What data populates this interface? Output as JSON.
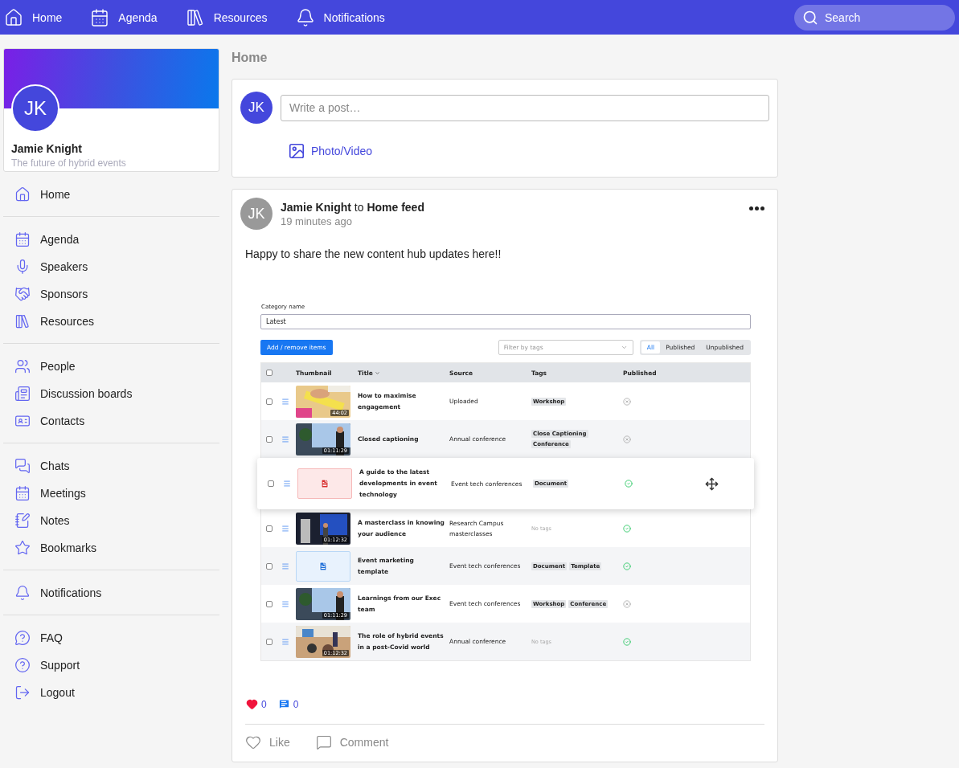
{
  "topnav": {
    "items": [
      {
        "label": "Home"
      },
      {
        "label": "Agenda"
      },
      {
        "label": "Resources"
      },
      {
        "label": "Notifications"
      }
    ],
    "search": {
      "placeholder": "Search"
    }
  },
  "profile": {
    "initials": "JK",
    "name": "Jamie Knight",
    "tagline": "The future of hybrid events"
  },
  "sidebar": {
    "groups": [
      {
        "items": [
          {
            "label": "Home"
          }
        ]
      },
      {
        "items": [
          {
            "label": "Agenda"
          },
          {
            "label": "Speakers"
          },
          {
            "label": "Sponsors"
          },
          {
            "label": "Resources"
          }
        ]
      },
      {
        "items": [
          {
            "label": "People"
          },
          {
            "label": "Discussion boards"
          },
          {
            "label": "Contacts"
          }
        ]
      },
      {
        "items": [
          {
            "label": "Chats"
          },
          {
            "label": "Meetings"
          },
          {
            "label": "Notes"
          },
          {
            "label": "Bookmarks"
          }
        ]
      },
      {
        "items": [
          {
            "label": "Notifications"
          }
        ]
      },
      {
        "items": [
          {
            "label": "FAQ"
          },
          {
            "label": "Support"
          },
          {
            "label": "Logout"
          }
        ]
      }
    ]
  },
  "page_title": "Home",
  "composer": {
    "initials": "JK",
    "placeholder": "Write a post…",
    "photo_label": "Photo/Video"
  },
  "post": {
    "initials": "JK",
    "author": "Jamie Knight",
    "connector": "to",
    "target": "Home feed",
    "time": "19 minutes ago",
    "text": "Happy to share the new content hub updates here!!",
    "embed": {
      "category_label": "Category name",
      "category_value": "Latest",
      "add_button": "Add / remove items",
      "filter_placeholder": "Filter by tags",
      "segments": [
        {
          "label": "All",
          "selected": true
        },
        {
          "label": "Published",
          "selected": false
        },
        {
          "label": "Unpublished",
          "selected": false
        }
      ],
      "header_checked": false,
      "columns": [
        "Thumbnail",
        "Title",
        "Source",
        "Tags",
        "Published"
      ],
      "rows": [
        {
          "kind": "video",
          "checked": false,
          "dragging": false,
          "duration": "44:02",
          "title": "How to maximise engagement",
          "source": "Uploaded",
          "tags": [
            "Workshop"
          ],
          "published": false
        },
        {
          "kind": "video",
          "checked": false,
          "dragging": false,
          "duration": "01:11:29",
          "title": "Closed captioning",
          "source": "Annual conference",
          "tags": [
            "Close Captioning",
            "Conference"
          ],
          "published": false
        },
        {
          "kind": "pdf",
          "checked": false,
          "dragging": true,
          "title": "A guide to the latest developments in event technology",
          "source": "Event tech conferences",
          "tags": [
            "Document"
          ],
          "published": true
        },
        {
          "kind": "video",
          "checked": false,
          "dragging": false,
          "duration": "01:12:32",
          "title": "A masterclass in knowing your audience",
          "source": "Research Campus masterclasses",
          "tags_note": "No tags",
          "published": true
        },
        {
          "kind": "word",
          "checked": false,
          "dragging": false,
          "title": "Event marketing template",
          "source": "Event tech conferences",
          "tags": [
            "Document",
            "Template"
          ],
          "published": true
        },
        {
          "kind": "video",
          "checked": false,
          "dragging": false,
          "duration": "01:11:29",
          "title": "Learnings from our Exec team",
          "source": "Event tech conferences",
          "tags": [
            "Workshop",
            "Conference"
          ],
          "published": false
        },
        {
          "kind": "video",
          "checked": false,
          "dragging": false,
          "duration": "01:12:32",
          "title": "The role of hybrid events in a post-Covid world",
          "source": "Annual conference",
          "tags_note": "No tags",
          "published": true
        }
      ]
    },
    "like_count": "0",
    "comment_count": "0",
    "liked": true,
    "actions": [
      {
        "label": "Like"
      },
      {
        "label": "Comment"
      }
    ]
  }
}
